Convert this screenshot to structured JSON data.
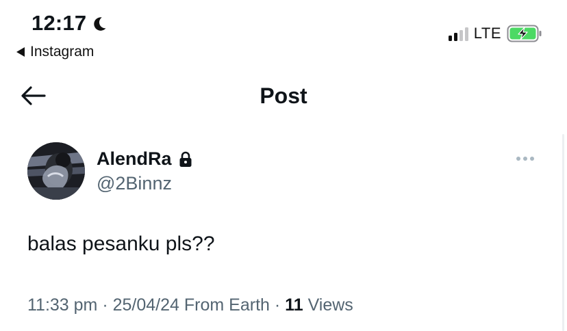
{
  "status_bar": {
    "time": "12:17",
    "back_app_label": "Instagram",
    "network": "LTE",
    "icons": [
      "moon-icon",
      "signal-icon",
      "battery-charging-icon"
    ],
    "battery_color": "#4cd964"
  },
  "nav": {
    "title": "Post",
    "back_icon": "arrow-left-icon"
  },
  "post": {
    "display_name": "AlendRa",
    "protected_icon": "lock-icon",
    "handle": "@2Binnz",
    "text": "balas pesanku pls??",
    "time": "11:33 pm",
    "date": "25/04/24",
    "source": "From Earth",
    "views_count": "11",
    "views_label": "Views",
    "more_icon": "more-horizontal-icon"
  },
  "colors": {
    "primary_text": "#0f1419",
    "secondary_text": "#536471"
  }
}
